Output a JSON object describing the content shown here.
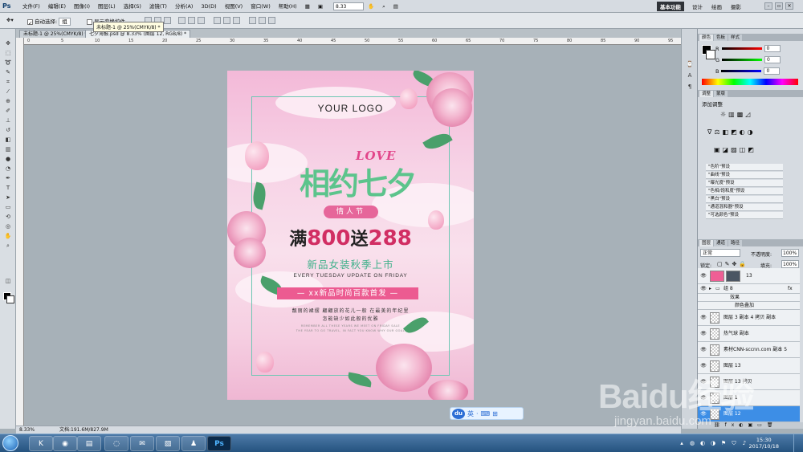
{
  "app": {
    "logo": "Ps"
  },
  "menubar": {
    "items": [
      "文件(F)",
      "编辑(E)",
      "图像(I)",
      "图层(L)",
      "选择(S)",
      "滤镜(T)",
      "分析(A)",
      "3D(D)",
      "视图(V)",
      "窗口(W)",
      "帮助(H)"
    ],
    "zoom": "8.33",
    "workspaces": [
      "基本功能",
      "设计",
      "绘画",
      "摄影"
    ]
  },
  "options": {
    "auto_select_label": "自动选择:",
    "auto_select_value": "组",
    "show_transform_label": "显示变换控件"
  },
  "tooltip": "未标题-1 @ 25%(CMYK/8) *",
  "doc_tabs": [
    "未标题-1 @ 25%(CMYK/8) *",
    "七夕海报.psd @ 8.33% (图层 12, RGB/8) *"
  ],
  "status": {
    "zoom": "8.33%",
    "doc_info": "文档:191.6M/827.9M"
  },
  "poster": {
    "logo": "YOUR LOGO",
    "love": "LOVE",
    "headline": "相约七夕",
    "sub_badge": "情人节",
    "offer_pre": "满",
    "offer_num1": "800",
    "offer_mid": "送",
    "offer_num2": "288",
    "new_season": "新品女装秋季上市",
    "every_tuesday": "EVERY TUESDAY UPDATE ON FRIDAY",
    "bar_text": "— xx新品时尚百款首发 —",
    "body1": "靓丽的裙摆  翩翩放的花儿一般  在最美的年纪里",
    "body2": "怎能缺少如此般的优雅",
    "fine1": "REMEMBER ALL THESE YEARS WE MEET ON FRIDAY SALE",
    "fine2": "THE YEAR TO GO TRAVEL, IN FACT YOU KNOW WHY OUR GOAL"
  },
  "dubar": {
    "logo": "du",
    "items": [
      "英",
      "·",
      "⌨",
      "⊞"
    ]
  },
  "right_panel": {
    "color_tabs": [
      "颜色",
      "色板",
      "样式"
    ],
    "rgb": [
      {
        "label": "R",
        "value": "0",
        "color": "#e02020"
      },
      {
        "label": "G",
        "value": "0",
        "color": "#20b020"
      },
      {
        "label": "B",
        "value": "0",
        "color": "#2040e0"
      }
    ],
    "adjust_tabs": [
      "调整",
      "蒙版"
    ],
    "adjust_title": "添加调整",
    "presets": [
      "\"色阶\"预设",
      "\"曲线\"预设",
      "\"曝光度\"预设",
      "\"色相/饱和度\"预设",
      "\"黑白\"预设",
      "\"通道混和器\"预设",
      "\"可选颜色\"预设"
    ],
    "layer_tabs": [
      "图层",
      "通道",
      "路径"
    ],
    "blend_mode": "正常",
    "opacity_label": "不透明度:",
    "opacity_value": "100%",
    "lock_label": "锁定:",
    "fill_label": "填充:",
    "fill_value": "100%",
    "layers": [
      "13",
      "组 8",
      "效果",
      "颜色叠加",
      "图层 3 副本 4 拷贝 副本",
      "热气球 副本",
      "素材CNN-sccnn.com 副本 5",
      "图层 13",
      "图层 13 拷贝",
      "图层 1",
      "图层 12"
    ]
  },
  "taskbar": {
    "time": "15:30",
    "date": "2017/10/18",
    "ps_label": "Ps"
  },
  "watermark": {
    "brand": "Baidu经验",
    "url": "jingyan.baidu.com"
  }
}
